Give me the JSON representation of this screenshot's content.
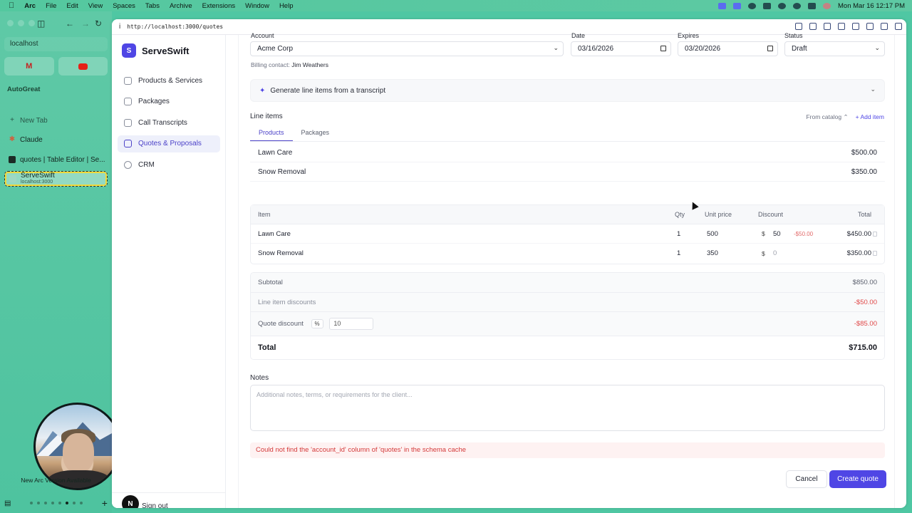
{
  "menubar": {
    "app": "Arc",
    "items": [
      "File",
      "Edit",
      "View",
      "Spaces",
      "Tabs",
      "Archive",
      "Extensions",
      "Window",
      "Help"
    ],
    "clock": "Mon Mar 16  12:17 PM"
  },
  "arc": {
    "url_label": "localhost",
    "space": "AutoGreat",
    "new_tab": "New Tab",
    "tabs": [
      {
        "label": "Claude"
      },
      {
        "label": "quotes | Table Editor | Se..."
      },
      {
        "label": "ServeSwift",
        "sub": "localhost:3000"
      }
    ],
    "update": "New Arc Version Available"
  },
  "browser": {
    "url": "http://localhost:3000/quotes"
  },
  "app": {
    "brand_initial": "S",
    "brand_name": "ServeSwift",
    "nav": [
      {
        "label": "Products & Services"
      },
      {
        "label": "Packages"
      },
      {
        "label": "Call Transcripts"
      },
      {
        "label": "Quotes & Proposals"
      },
      {
        "label": "CRM"
      }
    ],
    "user_initial": "N",
    "signout": "Sign out"
  },
  "form": {
    "account_label": "Account",
    "account_value": "Acme Corp",
    "date_label": "Date",
    "date_value": "03/16/2026",
    "expires_label": "Expires",
    "expires_value": "03/20/2026",
    "status_label": "Status",
    "status_value": "Draft",
    "billing_prefix": "Billing contact:",
    "billing_name": "Jim Weathers",
    "generate": "Generate line items from a transcript",
    "line_items_title": "Line items",
    "from_catalog": "From catalog",
    "add_item": "+ Add item",
    "tabs": [
      "Products",
      "Packages"
    ],
    "catalog": [
      {
        "name": "Lawn Care",
        "price": "$500.00"
      },
      {
        "name": "Snow Removal",
        "price": "$350.00"
      }
    ],
    "table": {
      "headers": {
        "item": "Item",
        "qty": "Qty",
        "unit": "Unit price",
        "discount": "Discount",
        "total": "Total"
      },
      "rows": [
        {
          "item": "Lawn Care",
          "qty": "1",
          "unit": "500",
          "dollar": "$",
          "discount": "50",
          "discount_amount": "-$50.00",
          "total": "$450.00"
        },
        {
          "item": "Snow Removal",
          "qty": "1",
          "unit": "350",
          "dollar": "$",
          "discount": "0",
          "discount_amount": "",
          "total": "$350.00"
        }
      ]
    },
    "summary": {
      "subtotal_label": "Subtotal",
      "subtotal": "$850.00",
      "line_disc_label": "Line item discounts",
      "line_disc": "-$50.00",
      "quote_disc_label": "Quote discount",
      "quote_disc_unit": "%",
      "quote_disc_value": "10",
      "quote_disc": "-$85.00",
      "total_label": "Total",
      "total": "$715.00"
    },
    "notes_label": "Notes",
    "notes_placeholder": "Additional notes, terms, or requirements for the client...",
    "error": "Could not find the 'account_id' column of 'quotes' in the schema cache",
    "cancel": "Cancel",
    "create": "Create quote"
  },
  "colors": {
    "accent": "#4f46e5",
    "error": "#d43a3a",
    "arc": "#54c89f"
  }
}
